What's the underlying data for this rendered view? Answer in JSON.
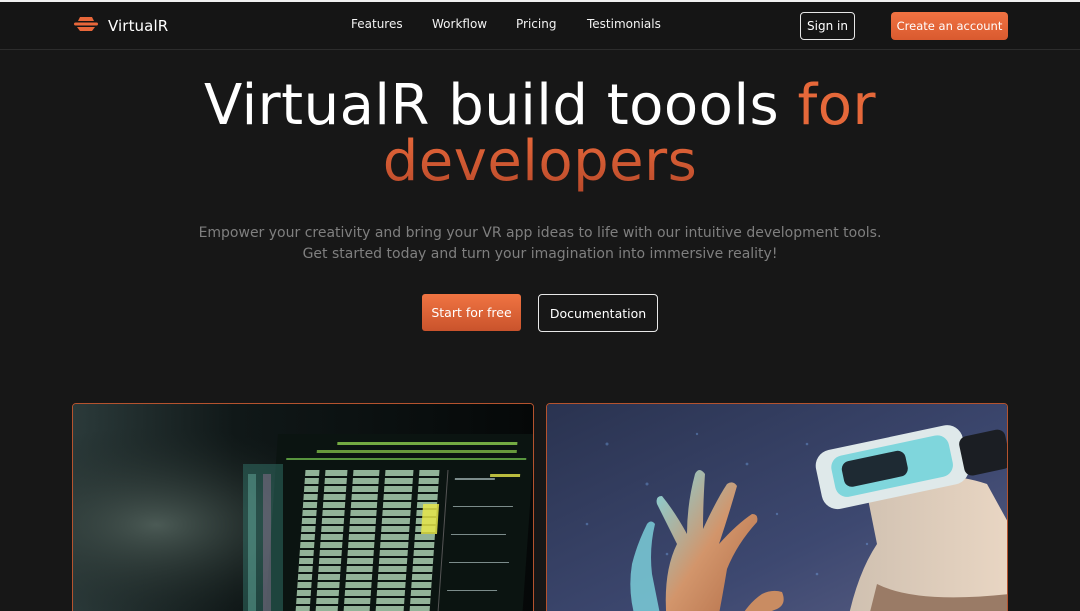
{
  "brand": {
    "name": "VirtualR"
  },
  "nav": {
    "items": [
      "Features",
      "Workflow",
      "Pricing",
      "Testimonials"
    ]
  },
  "header": {
    "sign_in": "Sign in",
    "create_account": "Create an account"
  },
  "hero": {
    "title_line1_main": "VirtualR build toools ",
    "title_line1_accent": "for",
    "title_line2_accent": "developers",
    "subtitle_line1": "Empower your creativity and bring your VR app ideas to life with our intuitive development tools.",
    "subtitle_line2": "Get started today and turn your imagination into immersive reality!",
    "primary_cta": "Start for free",
    "secondary_cta": "Documentation"
  },
  "colors": {
    "background": "#171717",
    "accent": "#e5683a",
    "card_border": "#b5532e",
    "subtitle": "#7f7f7f"
  },
  "icons": {
    "logo": "layered-logo-icon"
  }
}
